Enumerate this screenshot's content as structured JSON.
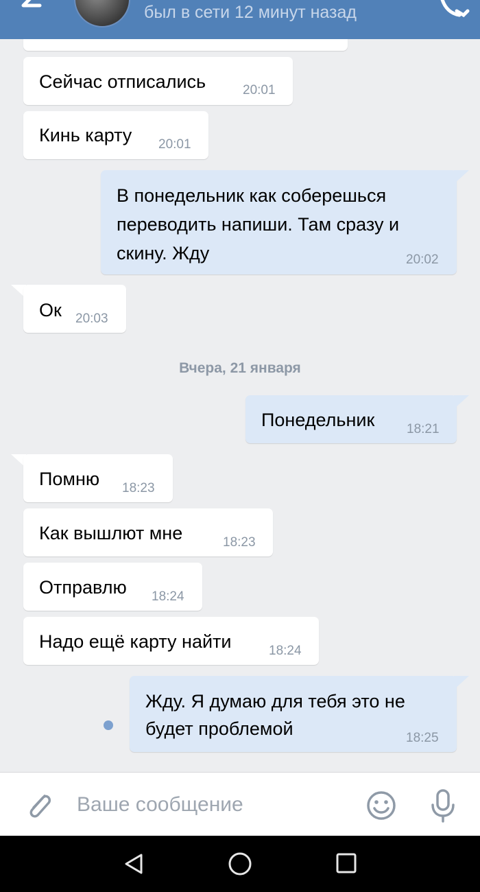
{
  "header": {
    "status": "был в сети 12 минут назад"
  },
  "messages": [
    {
      "text": "Сейчас отписались",
      "time": "20:01"
    },
    {
      "text": "Кинь карту",
      "time": "20:01"
    },
    {
      "line1": "В понедельник как соберешься",
      "line2": "переводить напиши. Там сразу и",
      "line3": "скину. Жду",
      "time": "20:02"
    },
    {
      "text": "Ок",
      "time": "20:03"
    },
    {
      "text": "Понедельник",
      "time": "18:21"
    },
    {
      "text": "Помню",
      "time": "18:23"
    },
    {
      "text": "Как вышлют мне",
      "time": "18:23"
    },
    {
      "text": "Отправлю",
      "time": "18:24"
    },
    {
      "text": "Надо ещё карту найти",
      "time": "18:24"
    },
    {
      "line1": "Жду. Я думаю для тебя это не",
      "line2": "будет проблемой",
      "time": "18:25"
    }
  ],
  "date_separator": "Вчера, 21 января",
  "input": {
    "placeholder": "Ваше сообщение"
  },
  "icons": [
    "back-arrow-icon",
    "phone-icon",
    "paperclip-icon",
    "smile-icon",
    "mic-icon",
    "nav-back-icon",
    "nav-home-icon",
    "nav-recent-icon"
  ]
}
